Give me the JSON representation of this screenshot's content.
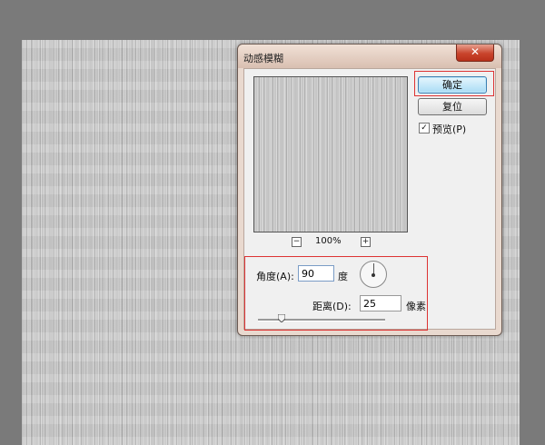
{
  "dialog": {
    "title": "动感模糊",
    "close_glyph": "✕",
    "ok_label": "确定",
    "reset_label": "复位",
    "preview_label": "预览(P)",
    "preview_checked": true,
    "zoom_level": "100%",
    "zoom_minus": "−",
    "zoom_plus": "+",
    "angle_label": "角度(A):",
    "angle_value": "90",
    "angle_unit": "度",
    "distance_label": "距离(D):",
    "distance_value": "25",
    "distance_unit": "像素"
  },
  "colors": {
    "workspace": "#7a7a7a",
    "highlight": "#dd3333",
    "ok_button": "#a9dcf5",
    "close_button": "#c9442c"
  }
}
